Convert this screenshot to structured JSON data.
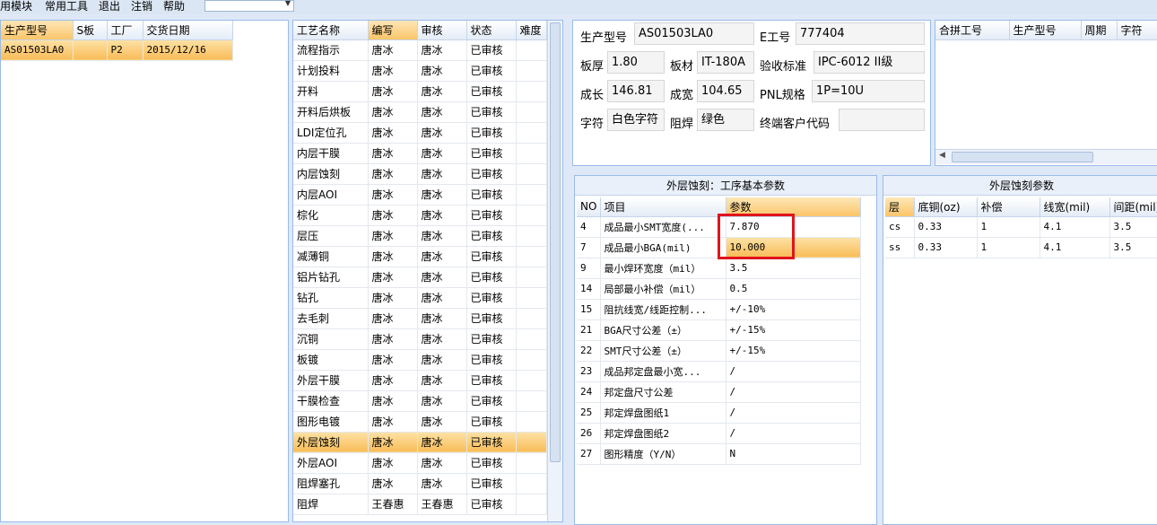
{
  "menu": {
    "module": "用模块",
    "tools": "常用工具",
    "exit": "退出",
    "logout": "注销",
    "help": "帮助",
    "combo_value": ""
  },
  "orders": {
    "columns": [
      "生产型号",
      "S板",
      "工厂",
      "交货日期"
    ],
    "rows": [
      [
        "AS01503LA0",
        "",
        "P2",
        "2015/12/16"
      ]
    ]
  },
  "process": {
    "columns": [
      "工艺名称",
      "编写",
      "审核",
      "状态",
      "难度"
    ],
    "rows": [
      [
        "流程指示",
        "唐冰",
        "唐冰",
        "已审核",
        ""
      ],
      [
        "计划投料",
        "唐冰",
        "唐冰",
        "已审核",
        ""
      ],
      [
        "开料",
        "唐冰",
        "唐冰",
        "已审核",
        ""
      ],
      [
        "开料后烘板",
        "唐冰",
        "唐冰",
        "已审核",
        ""
      ],
      [
        "LDI定位孔",
        "唐冰",
        "唐冰",
        "已审核",
        ""
      ],
      [
        "内层干膜",
        "唐冰",
        "唐冰",
        "已审核",
        ""
      ],
      [
        "内层蚀刻",
        "唐冰",
        "唐冰",
        "已审核",
        ""
      ],
      [
        "内层AOI",
        "唐冰",
        "唐冰",
        "已审核",
        ""
      ],
      [
        "棕化",
        "唐冰",
        "唐冰",
        "已审核",
        ""
      ],
      [
        "层压",
        "唐冰",
        "唐冰",
        "已审核",
        ""
      ],
      [
        "减薄铜",
        "唐冰",
        "唐冰",
        "已审核",
        ""
      ],
      [
        "铝片钻孔",
        "唐冰",
        "唐冰",
        "已审核",
        ""
      ],
      [
        "钻孔",
        "唐冰",
        "唐冰",
        "已审核",
        ""
      ],
      [
        "去毛刺",
        "唐冰",
        "唐冰",
        "已审核",
        ""
      ],
      [
        "沉铜",
        "唐冰",
        "唐冰",
        "已审核",
        ""
      ],
      [
        "板镀",
        "唐冰",
        "唐冰",
        "已审核",
        ""
      ],
      [
        "外层干膜",
        "唐冰",
        "唐冰",
        "已审核",
        ""
      ],
      [
        "干膜检查",
        "唐冰",
        "唐冰",
        "已审核",
        ""
      ],
      [
        "图形电镀",
        "唐冰",
        "唐冰",
        "已审核",
        ""
      ],
      [
        "外层蚀刻",
        "唐冰",
        "唐冰",
        "已审核",
        ""
      ],
      [
        "外层AOI",
        "唐冰",
        "唐冰",
        "已审核",
        ""
      ],
      [
        "阻焊塞孔",
        "唐冰",
        "唐冰",
        "已审核",
        ""
      ],
      [
        "阻焊",
        "王春惠",
        "王春惠",
        "已审核",
        ""
      ]
    ],
    "selected_index": 19
  },
  "info": {
    "model_label": "生产型号",
    "model_value": "AS01503LA0",
    "eno_label": "E工号",
    "eno_value": "777404",
    "thickness_label": "板厚",
    "thickness_value": "1.80",
    "material_label": "板材",
    "material_value": "IT-180A",
    "standard_label": "验收标准",
    "standard_value": "IPC-6012 II级",
    "length_label": "成长",
    "length_value": "146.81",
    "width_label": "成宽",
    "width_value": "104.65",
    "pnl_label": "PNL规格",
    "pnl_value": "1P=10U",
    "legend_label": "字符",
    "legend_value": "白色字符",
    "mask_label": "阻焊",
    "mask_value": "绿色",
    "customer_label": "终端客户代码",
    "customer_value": ""
  },
  "merge": {
    "columns": [
      "合拼工号",
      "生产型号",
      "周期",
      "字符"
    ]
  },
  "basic_params": {
    "title": "外层蚀刻：工序基本参数",
    "columns": [
      "NO",
      "项目",
      "参数"
    ],
    "rows": [
      [
        "4",
        "成品最小SMT宽度(...",
        "7.870"
      ],
      [
        "7",
        "成品最小BGA(mil)",
        "10.000"
      ],
      [
        "9",
        "最小焊环宽度（mil）",
        "3.5"
      ],
      [
        "14",
        "局部最小补偿（mil）",
        "0.5"
      ],
      [
        "15",
        "阻抗线宽/线距控制...",
        "+/-10%"
      ],
      [
        "21",
        "BGA尺寸公差（±）",
        "+/-15%"
      ],
      [
        "22",
        "SMT尺寸公差（±）",
        "+/-15%"
      ],
      [
        "23",
        "成品邦定盘最小宽...",
        "/"
      ],
      [
        "24",
        "邦定盘尺寸公差",
        "/"
      ],
      [
        "25",
        "邦定焊盘图纸1",
        "/"
      ],
      [
        "26",
        "邦定焊盘图纸2",
        "/"
      ],
      [
        "27",
        "图形精度（Y/N）",
        "N"
      ]
    ]
  },
  "etch_params": {
    "title": "外层蚀刻参数",
    "columns": [
      "层",
      "底铜(oz)",
      "补偿",
      "线宽(mil)",
      "间距(mil)"
    ],
    "rows": [
      [
        "cs",
        "0.33",
        "1",
        "4.1",
        "3.5"
      ],
      [
        "ss",
        "0.33",
        "1",
        "4.1",
        "3.5"
      ]
    ]
  },
  "colors": {
    "selection": "#fbc56a",
    "annotation_red": "#e0141c",
    "panel_border": "#99bbe8"
  }
}
